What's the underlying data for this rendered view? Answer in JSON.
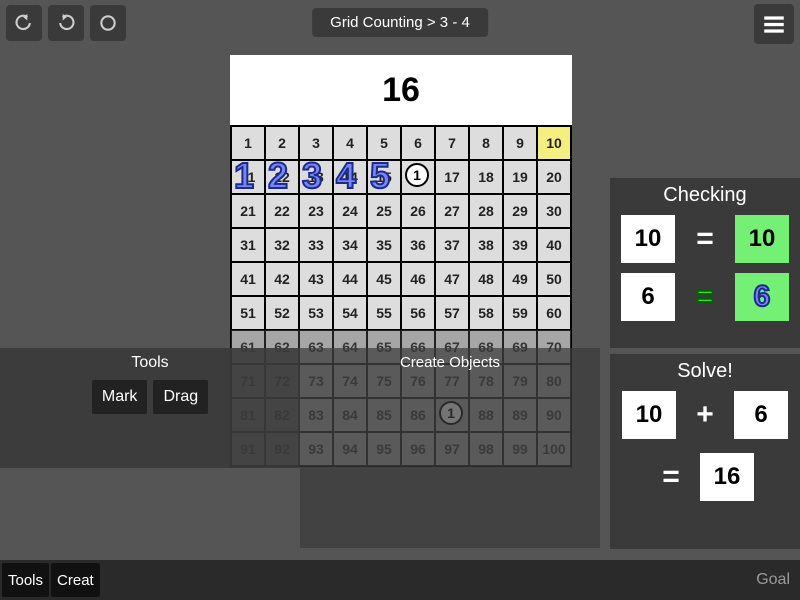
{
  "breadcrumb": "Grid Counting > 3 - 4",
  "target_number": "16",
  "grid": {
    "rows": 10,
    "cols": 10,
    "highlight_cell": 10
  },
  "overlays": {
    "bignums": [
      "1",
      "2",
      "3",
      "4",
      "5"
    ],
    "circle_label": "1"
  },
  "tools": {
    "title": "Tools",
    "buttons": [
      "Mark",
      "Drag"
    ]
  },
  "create": {
    "title": "Create Objects"
  },
  "checking": {
    "title": "Checking",
    "rows": [
      {
        "left": "10",
        "op": "=",
        "right": "10",
        "op_green": false
      },
      {
        "left": "6",
        "op": "=",
        "right": "6",
        "op_green": true,
        "right_outlined": true
      }
    ]
  },
  "solve": {
    "title": "Solve!",
    "expr": {
      "a": "10",
      "op": "+",
      "b": "6",
      "eq": "=",
      "result": "16"
    }
  },
  "bottom_tabs": [
    "Tools",
    "Creat"
  ],
  "bottom_goal": "Goal"
}
